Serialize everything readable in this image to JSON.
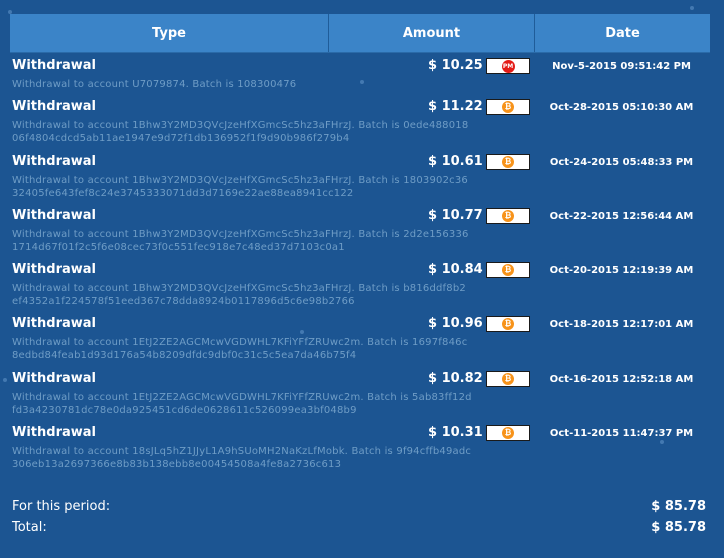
{
  "headers": {
    "type": "Type",
    "amount": "Amount",
    "date": "Date"
  },
  "rows": [
    {
      "title": "Withdrawal",
      "desc": "Withdrawal to account U7079874. Batch is 108300476",
      "amount": "$ 10.25",
      "ps": "pm-icon",
      "ps_text": "PM",
      "date": "Nov-5-2015 09:51:42 PM"
    },
    {
      "title": "Withdrawal",
      "desc": "Withdrawal to account 1Bhw3Y2MD3QVcJzeHfXGmcSc5hz3aFHrzJ. Batch is 0ede48801806f4804cdcd5ab11ae1947e9d72f1db136952f1f9d90b986f279b4",
      "amount": "$ 11.22",
      "ps": "bitcoin-icon",
      "ps_text": "₿",
      "date": "Oct-28-2015 05:10:30 AM"
    },
    {
      "title": "Withdrawal",
      "desc": "Withdrawal to account 1Bhw3Y2MD3QVcJzeHfXGmcSc5hz3aFHrzJ. Batch is 1803902c3632405fe643fef8c24e3745333071dd3d7169e22ae88ea8941cc122",
      "amount": "$ 10.61",
      "ps": "bitcoin-icon",
      "ps_text": "₿",
      "date": "Oct-24-2015 05:48:33 PM"
    },
    {
      "title": "Withdrawal",
      "desc": "Withdrawal to account 1Bhw3Y2MD3QVcJzeHfXGmcSc5hz3aFHrzJ. Batch is 2d2e1563361714d67f01f2c5f6e08cec73f0c551fec918e7c48ed37d7103c0a1",
      "amount": "$ 10.77",
      "ps": "bitcoin-icon",
      "ps_text": "₿",
      "date": "Oct-22-2015 12:56:44 AM"
    },
    {
      "title": "Withdrawal",
      "desc": "Withdrawal to account 1Bhw3Y2MD3QVcJzeHfXGmcSc5hz3aFHrzJ. Batch is b816ddf8b2ef4352a1f224578f51eed367c78dda8924b0117896d5c6e98b2766",
      "amount": "$ 10.84",
      "ps": "bitcoin-icon",
      "ps_text": "₿",
      "date": "Oct-20-2015 12:19:39 AM"
    },
    {
      "title": "Withdrawal",
      "desc": "Withdrawal to account 1EtJ2ZE2AGCMcwVGDWHL7KFiYFfZRUwc2m. Batch is 1697f846c8edbd84feab1d93d176a54b8209dfdc9dbf0c31c5c5ea7da46b75f4",
      "amount": "$ 10.96",
      "ps": "bitcoin-icon",
      "ps_text": "₿",
      "date": "Oct-18-2015 12:17:01 AM"
    },
    {
      "title": "Withdrawal",
      "desc": "Withdrawal to account 1EtJ2ZE2AGCMcwVGDWHL7KFiYFfZRUwc2m. Batch is 5ab83ff12dfd3a4230781dc78e0da925451cd6de0628611c526099ea3bf048b9",
      "amount": "$ 10.82",
      "ps": "bitcoin-icon",
      "ps_text": "₿",
      "date": "Oct-16-2015 12:52:18 AM"
    },
    {
      "title": "Withdrawal",
      "desc": "Withdrawal to account 18sJLq5hZ1JJyL1A9hSUoMH2NaKzLfMobk. Batch is 9f94cffb49adc306eb13a2697366e8b83b138ebb8e00454508a4fe8a2736c613",
      "amount": "$ 10.31",
      "ps": "bitcoin-icon",
      "ps_text": "₿",
      "date": "Oct-11-2015 11:47:37 PM"
    }
  ],
  "summary": {
    "period_label": "For this period:",
    "period_value": "$ 85.78",
    "total_label": "Total:",
    "total_value": "$ 85.78"
  }
}
